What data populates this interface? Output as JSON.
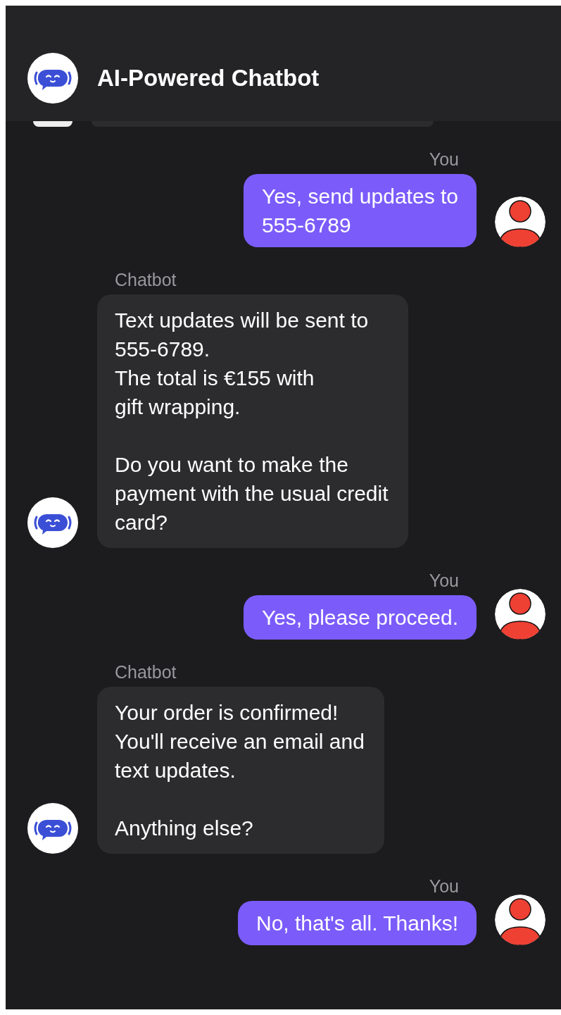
{
  "header": {
    "title": "AI-Powered Chatbot"
  },
  "messages": [
    {
      "kind": "user",
      "label": "You",
      "text": "Yes, send updates to\n555-6789"
    },
    {
      "kind": "bot",
      "label": "Chatbot",
      "text": "Text updates will be sent to\n555-6789.\nThe total is €155 with\ngift wrapping.\n\nDo you want to make the\npayment with the usual credit\ncard?"
    },
    {
      "kind": "user",
      "label": "You",
      "text": "Yes, please proceed."
    },
    {
      "kind": "bot",
      "label": "Chatbot",
      "text": "Your order is confirmed!\nYou'll receive an email and\ntext updates.\n\nAnything else?"
    },
    {
      "kind": "user",
      "label": "You",
      "text": "No, that's all. Thanks!"
    }
  ]
}
